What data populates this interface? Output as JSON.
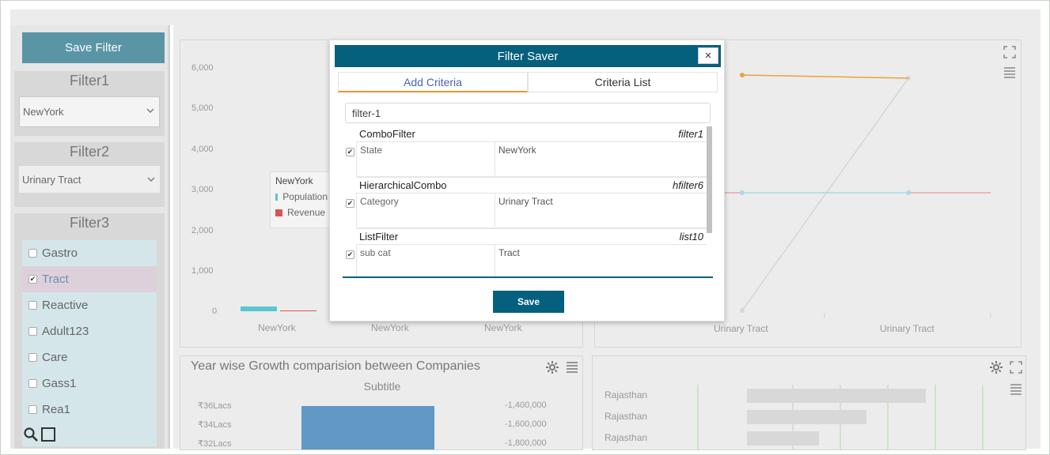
{
  "sidebar": {
    "save_filter_label": "Save Filter",
    "filter1": {
      "title": "Filter1",
      "selected": "NewYork"
    },
    "filter2": {
      "title": "Filter2",
      "selected": "Urinary Tract"
    },
    "filter3": {
      "title": "Filter3",
      "items": [
        {
          "label": "Gastro",
          "checked": false
        },
        {
          "label": "Tract",
          "checked": true
        },
        {
          "label": "Reactive",
          "checked": false
        },
        {
          "label": "Adult123",
          "checked": false
        },
        {
          "label": "Care",
          "checked": false
        },
        {
          "label": "Gass1",
          "checked": false
        },
        {
          "label": "Rea1",
          "checked": false
        }
      ]
    }
  },
  "panel1": {
    "y_ticks": [
      "6,000",
      "5,000",
      "4,000",
      "3,000",
      "2,000",
      "1,000",
      "0"
    ],
    "x_labels": [
      "NewYork",
      "NewYork",
      "NewYork"
    ],
    "tooltip": {
      "title": "NewYork",
      "items": [
        "Population",
        "Revenue"
      ]
    },
    "colors": {
      "population": "#5bc6d0",
      "revenue": "#d9534f"
    }
  },
  "panel2": {
    "x_labels": [
      "Urinary Tract",
      "Urinary Tract"
    ],
    "colors": {
      "orange": "#e8a33c",
      "blue": "#a9d8ea",
      "red": "#e06060",
      "gray": "#d6d6d6"
    }
  },
  "panel3": {
    "title": "Year wise Growth comparision between Companies",
    "subtitle": "Subtitle",
    "y_left": [
      "₹36Lacs",
      "₹34Lacs",
      "₹32Lacs"
    ],
    "y_right": [
      "-1,400,000",
      "-1,600,000",
      "-1,800,000"
    ],
    "bar_color": "#6098c6"
  },
  "panel4": {
    "labels": [
      "Rajasthan",
      "Rajasthan",
      "Rajasthan"
    ]
  },
  "modal": {
    "title": "Filter Saver",
    "close_label": "×",
    "tabs": [
      "Add Criteria",
      "Criteria List"
    ],
    "filter_name": "filter-1",
    "criteria": [
      {
        "type": "ComboFilter",
        "id": "filter1",
        "field": "State",
        "value": "NewYork"
      },
      {
        "type": "HierarchicalCombo",
        "id": "hfilter6",
        "field": "Category",
        "value": "Urinary Tract"
      },
      {
        "type": "ListFilter",
        "id": "list10",
        "field": "sub cat",
        "value": "Tract"
      }
    ],
    "save_label": "Save"
  }
}
